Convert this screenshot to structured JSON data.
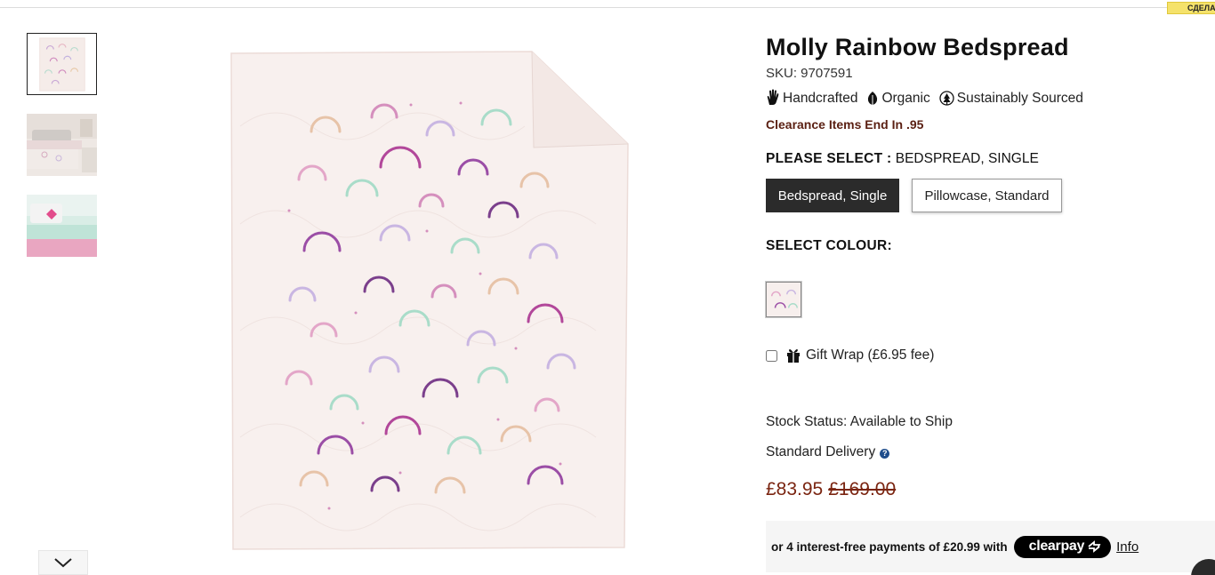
{
  "corner_badge": "СДЕЛА",
  "product": {
    "title": "Molly Rainbow Bedspread",
    "sku": "SKU: 9707591",
    "features": [
      {
        "icon": "hand-icon",
        "label": "Handcrafted"
      },
      {
        "icon": "organic-leaf-icon",
        "label": "Organic"
      },
      {
        "icon": "tree-icon",
        "label": "Sustainably Sourced"
      }
    ],
    "clearance": "Clearance Items End In .95"
  },
  "selection": {
    "label": "PLEASE SELECT :",
    "value": "BEDSPREAD, SINGLE",
    "options": [
      {
        "label": "Bedspread, Single",
        "selected": true
      },
      {
        "label": "Pillowcase, Standard",
        "selected": false
      }
    ]
  },
  "colour": {
    "label": "SELECT COLOUR:"
  },
  "gift_wrap": {
    "label": "Gift Wrap (£6.95 fee)",
    "checked": false
  },
  "stock_status": "Stock Status: Available to Ship",
  "delivery": "Standard Delivery",
  "help_glyph": "?",
  "price": {
    "sale": "£83.95",
    "was": "£169.00"
  },
  "clearpay": {
    "text": "or 4 interest-free payments of £20.99 with",
    "brand": "clearpay",
    "info": "Info"
  },
  "colors": {
    "accent_dark": "#2b2b2b",
    "price_red": "#7a2410",
    "clearance_brown": "#5a1f12",
    "help_blue": "#1f4d8c"
  }
}
